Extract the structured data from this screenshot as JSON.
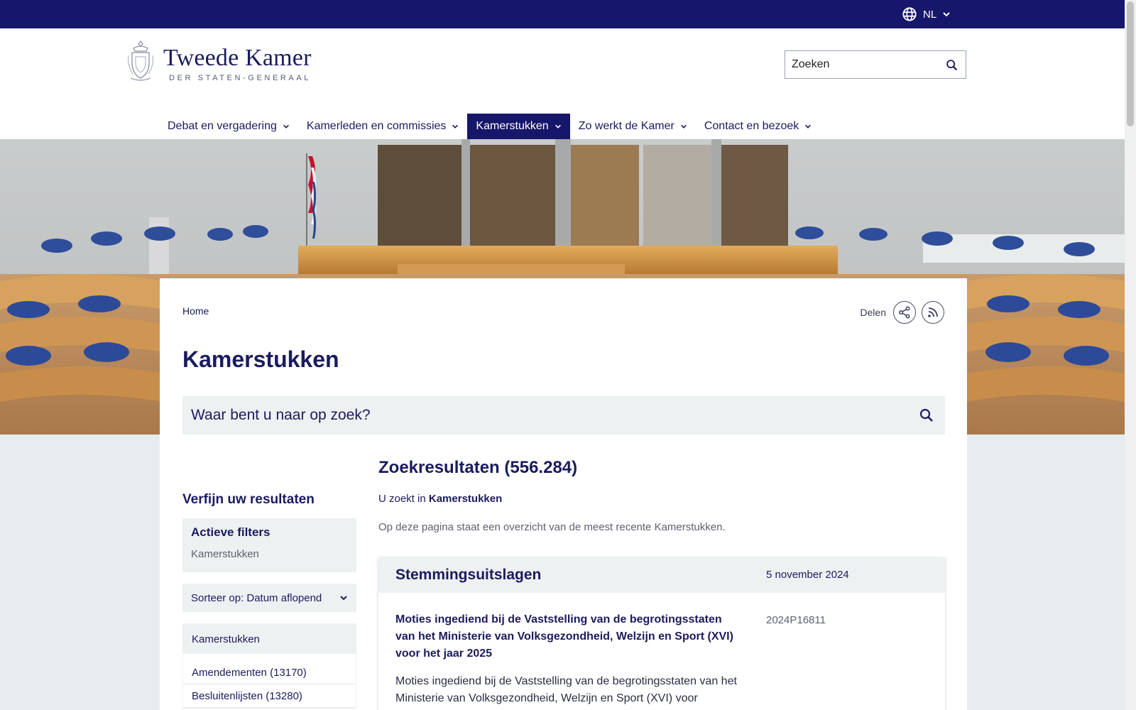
{
  "topbar": {
    "language": "NL"
  },
  "header": {
    "logo_title": "Tweede Kamer",
    "logo_subtitle": "DER STATEN-GENERAAL",
    "search_placeholder": "Zoeken"
  },
  "nav": {
    "items": [
      {
        "label": "Debat en vergadering"
      },
      {
        "label": "Kamerleden en commissies"
      },
      {
        "label": "Kamerstukken"
      },
      {
        "label": "Zo werkt de Kamer"
      },
      {
        "label": "Contact en bezoek"
      }
    ],
    "active_index": 2
  },
  "breadcrumb": {
    "home": "Home"
  },
  "share": {
    "label": "Delen"
  },
  "page": {
    "title": "Kamerstukken"
  },
  "main_search": {
    "placeholder": "Waar bent u naar op zoek?"
  },
  "sidebar": {
    "refine_title": "Verfijn uw resultaten",
    "active_filters_title": "Actieve filters",
    "active_filter_value": "Kamerstukken",
    "sort_label": "Sorteer op: Datum aflopend",
    "facet_title": "Kamerstukken",
    "facet_items": [
      {
        "label": "Amendementen (13170)"
      },
      {
        "label": "Besluitenlijsten (13280)"
      }
    ]
  },
  "results": {
    "title": "Zoekresultaten (556.284)",
    "scope_prefix": "U zoekt in",
    "scope_value": "Kamerstukken",
    "intro": "Op deze pagina staat een overzicht van de meest recente Kamerstukken.",
    "items": [
      {
        "type": "Stemmingsuitslagen",
        "date": "5 november 2024",
        "title": "Moties ingediend bij de Vaststelling van de begrotingsstaten van het Ministerie van Volksgezondheid, Welzijn en Sport (XVI) voor het jaar 2025",
        "id": "2024P16811",
        "description": "Moties ingediend bij de Vaststelling van de begrotingsstaten van het Ministerie van Volksgezondheid, Welzijn en Sport (XVI) voor"
      }
    ]
  },
  "colors": {
    "brand_navy": "#16166b",
    "panel_gray": "#eef1f2",
    "page_bg": "#e6ecf0"
  },
  "icons": {
    "language": "globe-icon",
    "search": "search-icon",
    "share": "share-icon",
    "rss": "rss-icon",
    "dropdown": "chevron-down-icon"
  }
}
